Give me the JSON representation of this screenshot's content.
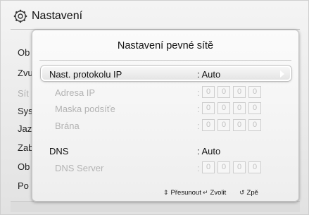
{
  "header": {
    "title": "Nastavení",
    "icon": "gear-icon"
  },
  "background_menu": {
    "items": [
      {
        "label": "Ob",
        "dim": false
      },
      {
        "label": "Zvu",
        "dim": false
      },
      {
        "label": "Sít",
        "dim": true
      },
      {
        "label": "Sys",
        "dim": false
      },
      {
        "label": "Jaz",
        "dim": false
      },
      {
        "label": "Zab",
        "dim": false
      },
      {
        "label": "Ob",
        "dim": false
      },
      {
        "label": "Po",
        "dim": false
      }
    ]
  },
  "dialog": {
    "title": "Nastavení pevné sítě",
    "rows": {
      "ip_protocol": {
        "label": "Nast. protokolu IP",
        "value": ": Auto"
      },
      "ip_address": {
        "label": "Adresa IP",
        "colon": ":",
        "octets": [
          "0",
          "0",
          "0",
          "0"
        ]
      },
      "subnet_mask": {
        "label": "Maska podsíťe",
        "colon": ":",
        "octets": [
          "0",
          "0",
          "0",
          "0"
        ]
      },
      "gateway": {
        "label": "Brána",
        "colon": ":",
        "octets": [
          "0",
          "0",
          "0",
          "0"
        ]
      },
      "dns": {
        "label": "DNS",
        "value": ": Auto"
      },
      "dns_server": {
        "label": "DNS Server",
        "colon": ":",
        "octets": [
          "0",
          "0",
          "0",
          "0"
        ]
      }
    },
    "footer": {
      "move": {
        "icon": "updown-arrows-icon",
        "label": "Přesunout"
      },
      "select": {
        "icon": "enter-icon",
        "label": "Zvolit"
      },
      "back": {
        "icon": "return-icon",
        "label": "Zpě"
      }
    }
  },
  "colors": {
    "selected_border": "#ffffff",
    "dim_text": "#b3b3b3",
    "dialog_bg": "#f4f4f4"
  }
}
